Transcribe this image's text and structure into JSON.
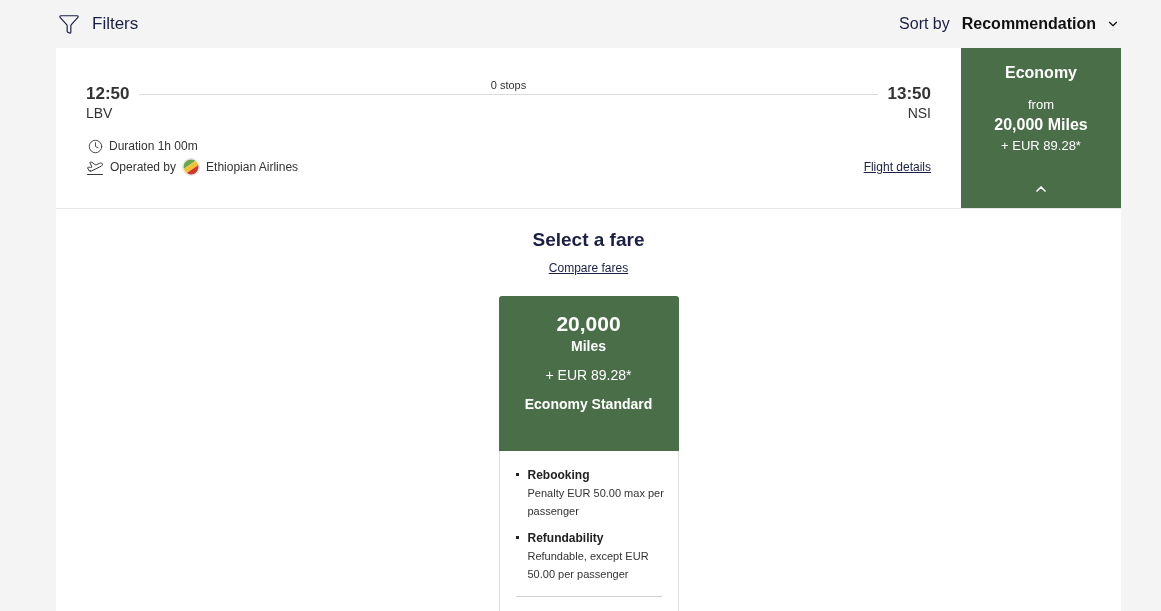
{
  "toolbar": {
    "filters_label": "Filters",
    "sort_label": "Sort by",
    "sort_value": "Recommendation"
  },
  "flight": {
    "departure": {
      "time": "12:50",
      "airport": "LBV"
    },
    "stops": "0 stops",
    "arrival": {
      "time": "13:50",
      "airport": "NSI"
    },
    "duration": "Duration 1h 00m",
    "operated_by": "Operated by",
    "airline": "Ethiopian Airlines",
    "details_link": "Flight details",
    "cabin": {
      "name": "Economy",
      "from": "from",
      "miles": "20,000 Miles",
      "fee": "+ EUR 89.28*",
      "expanded": true
    }
  },
  "fare_selection": {
    "title": "Select a fare",
    "compare_link": "Compare fares",
    "fares": [
      {
        "miles": "20,000",
        "miles_unit": "Miles",
        "fee": "+ EUR 89.28*",
        "name": "Economy Standard",
        "conditions": [
          {
            "title": "Rebooking",
            "text": "Penalty EUR 50.00 max per passenger"
          },
          {
            "title": "Refundability",
            "text": "Refundable, except EUR 50.00 per passenger"
          }
        ]
      }
    ]
  }
}
